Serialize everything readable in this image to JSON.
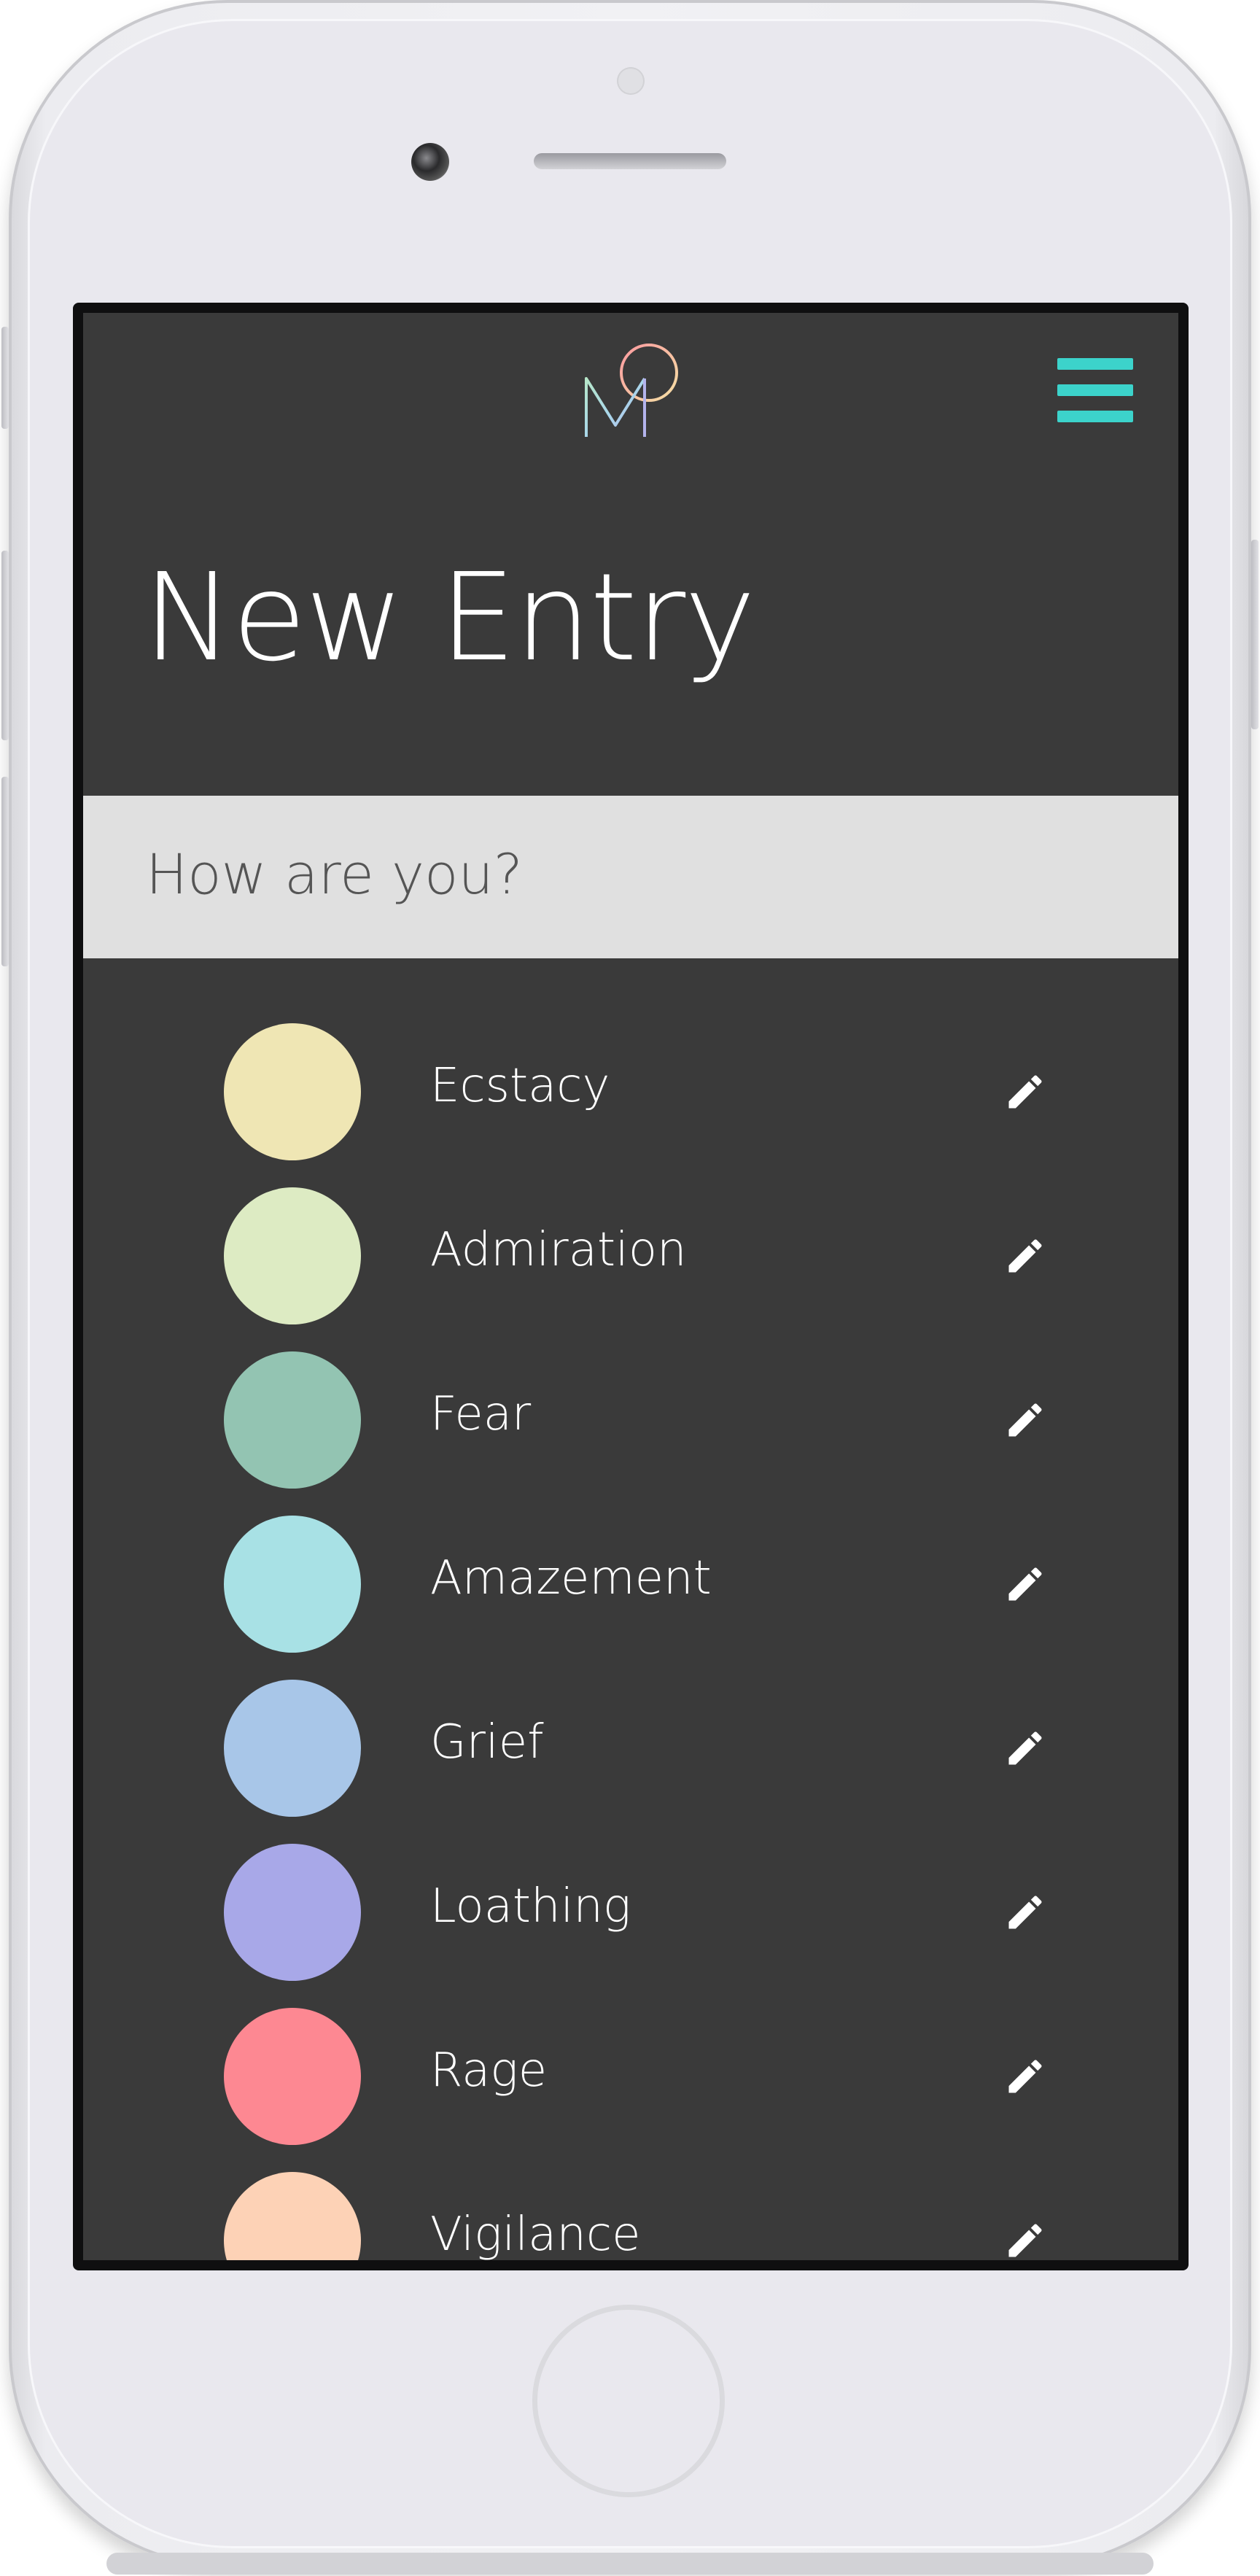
{
  "app": {
    "logo_name": "moodi-logo",
    "menu_icon": "hamburger-menu-icon",
    "accent_color": "#3cd3cb"
  },
  "page": {
    "title": "New Entry",
    "prompt": "How are you?"
  },
  "emotions": [
    {
      "label": "Ecstacy",
      "color": "#efe6b4",
      "edit_icon": "pencil-icon"
    },
    {
      "label": "Admiration",
      "color": "#ddebc3",
      "edit_icon": "pencil-icon"
    },
    {
      "label": "Fear",
      "color": "#93c4b2",
      "edit_icon": "pencil-icon"
    },
    {
      "label": "Amazement",
      "color": "#a8e1e5",
      "edit_icon": "pencil-icon"
    },
    {
      "label": "Grief",
      "color": "#a8c6e8",
      "edit_icon": "pencil-icon"
    },
    {
      "label": "Loathing",
      "color": "#a8a8e8",
      "edit_icon": "pencil-icon"
    },
    {
      "label": "Rage",
      "color": "#fd8892",
      "edit_icon": "pencil-icon"
    },
    {
      "label": "Vigilance",
      "color": "#fdd2b6",
      "edit_icon": "pencil-icon"
    }
  ]
}
